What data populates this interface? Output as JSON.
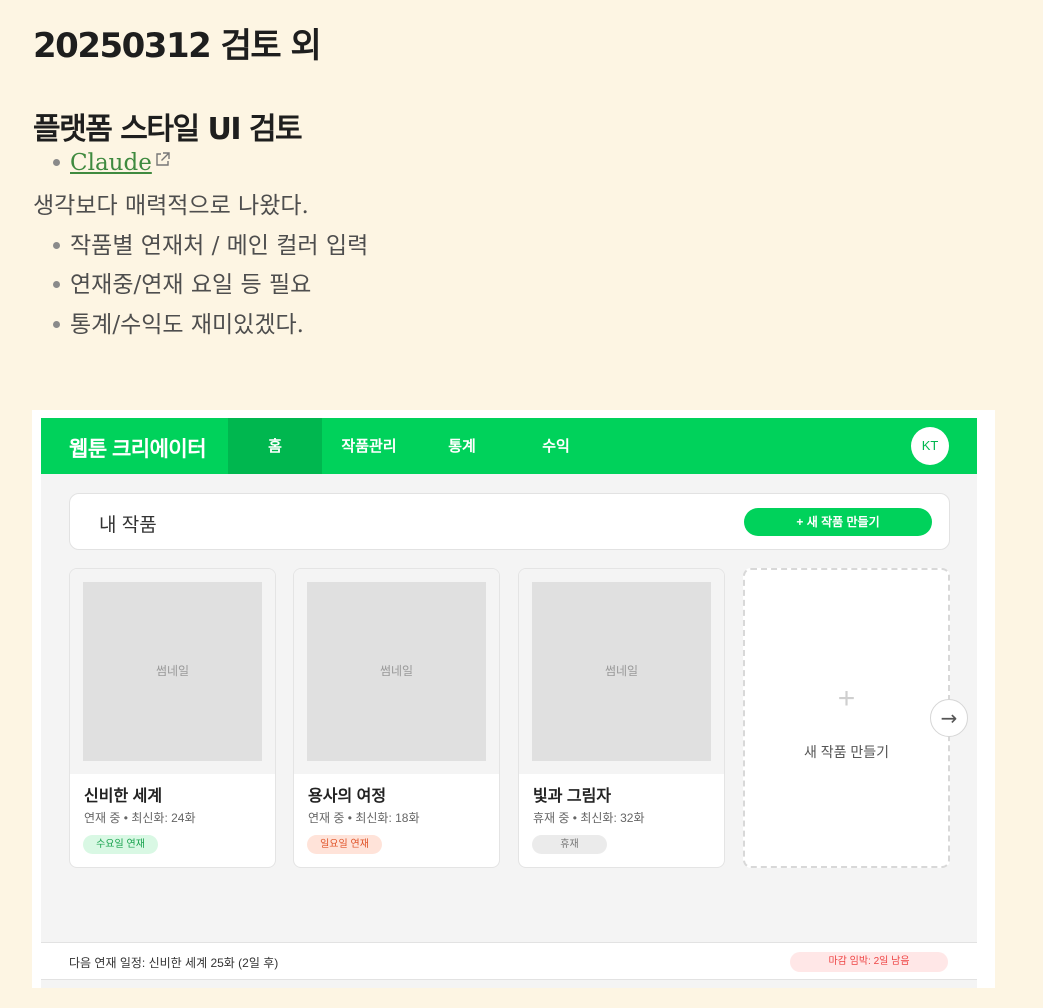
{
  "post": {
    "title": "20250312 검토 외",
    "section_title": "플랫폼 스타일 UI 검토",
    "link_text": "Claude",
    "paragraph": "생각보다 매력적으로 나왔다.",
    "bullets": [
      "작품별 연재처 / 메인 컬러 입력",
      "연재중/연재 요일 등 필요",
      "통계/수익도 재미있겠다."
    ]
  },
  "app": {
    "brand": "웹툰 크리에이터",
    "nav": [
      "홈",
      "작품관리",
      "통계",
      "수익"
    ],
    "avatar": "KT",
    "section_label": "내 작품",
    "new_button": "+ 새 작품 만들기",
    "cards": [
      {
        "thumb": "썸네일",
        "title": "신비한 세계",
        "meta": "연재 중 • 최신화: 24화",
        "badge": "수요일 연재",
        "badge_bg": "#d9f8e4",
        "badge_fg": "#1aa34f"
      },
      {
        "thumb": "썸네일",
        "title": "용사의 여정",
        "meta": "연재 중 • 최신화: 18화",
        "badge": "일요일 연재",
        "badge_bg": "#ffe3d9",
        "badge_fg": "#e0552a"
      },
      {
        "thumb": "썸네일",
        "title": "빛과 그림자",
        "meta": "휴재 중 • 최신화: 32화",
        "badge": "휴재",
        "badge_bg": "#ebebeb",
        "badge_fg": "#777777"
      }
    ],
    "add_card": {
      "plus": "+",
      "label": "새 작품 만들기"
    },
    "arrow": "→",
    "schedule": "다음 연재 일정: 신비한 세계 25화 (2일 후)",
    "deadline": "마감 임박: 2일 남음",
    "colors": {
      "accent": "#00d25b",
      "accent_dark": "#00b74f",
      "background": "#fdf5e3"
    }
  }
}
